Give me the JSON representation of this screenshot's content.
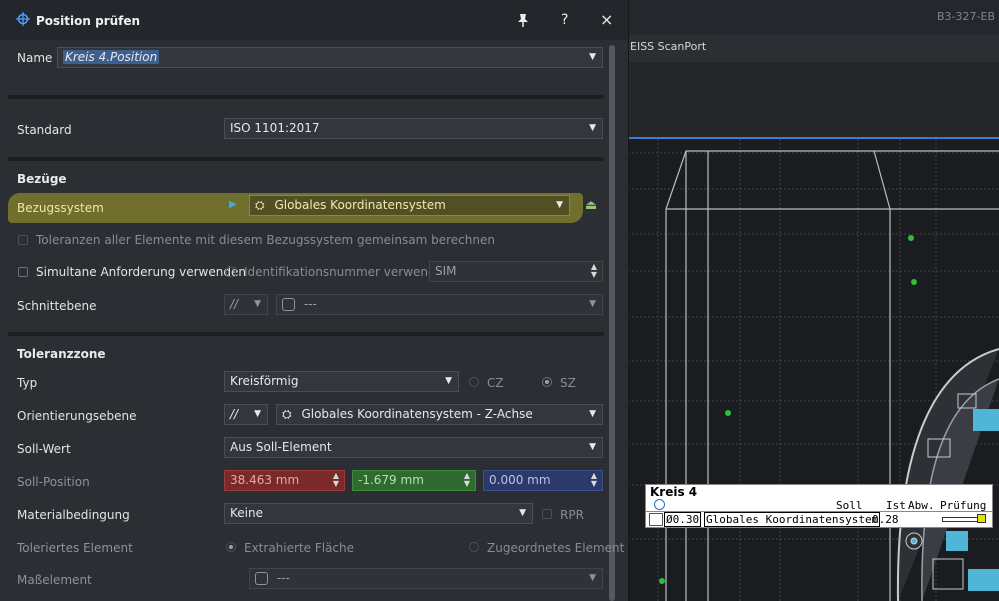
{
  "background": {
    "window_id": "B3-327-EB",
    "tab_label": "EISS ScanPort"
  },
  "dialog": {
    "title": "Position prüfen",
    "title_icon": "position-symbol-icon",
    "pin_icon": "pin-icon",
    "help_label": "?",
    "close_label": "×",
    "name": {
      "label": "Name",
      "value": "Kreis 4.Position"
    },
    "standard": {
      "label": "Standard",
      "value": "ISO 1101:2017"
    },
    "bezuege": {
      "section_label": "Bezüge",
      "bezugssystem_label": "Bezugssystem",
      "bezugssystem_value": "Globales Koordinatensystem",
      "tolerances_checkbox": "Toleranzen aller Elemente mit diesem Bezugssystem gemeinsam berechnen",
      "simultane_checkbox": "Simultane Anforderung verwenden",
      "ident_checkbox": "Identifikationsnummer verwenden",
      "ident_value": "SIM",
      "schnittebene_label": "Schnittebene",
      "schnittebene_symbol": "//",
      "schnittebene_value": "---"
    },
    "toleranzzone": {
      "section_label": "Toleranzzone",
      "typ_label": "Typ",
      "typ_value": "Kreisförmig",
      "cz_label": "CZ",
      "sz_label": "SZ",
      "orient_label": "Orientierungsebene",
      "orient_symbol": "//",
      "orient_value": "Globales Koordinatensystem - Z-Achse",
      "soll_wert_label": "Soll-Wert",
      "soll_wert_value": "Aus Soll-Element",
      "soll_position_label": "Soll-Position",
      "soll_x": "38.463 mm",
      "soll_y": "-1.679 mm",
      "soll_z": "0.000 mm",
      "material_label": "Materialbedingung",
      "material_value": "Keine",
      "rpr_label": "RPR",
      "toleriertes_label": "Toleriertes Element",
      "extrahierte_label": "Extrahierte Fläche",
      "zugeordnetes_label": "Zugeordnetes Element",
      "masselement_label": "Maßelement",
      "masselement_value": "---"
    }
  },
  "colors": {
    "x_field": "#7a2a2a",
    "y_field": "#2f6b2f",
    "z_field": "#2c3a6b",
    "highlight": "#aaa528",
    "accent_blue": "#2f82d6"
  },
  "result_table": {
    "title": "Kreis 4",
    "headers": [
      "Soll",
      "Ist",
      "Abw.",
      "Prüfung"
    ],
    "tolerance": "Ø0.30",
    "reference": "Globales Koordinatensystem",
    "ist": "0.28"
  }
}
